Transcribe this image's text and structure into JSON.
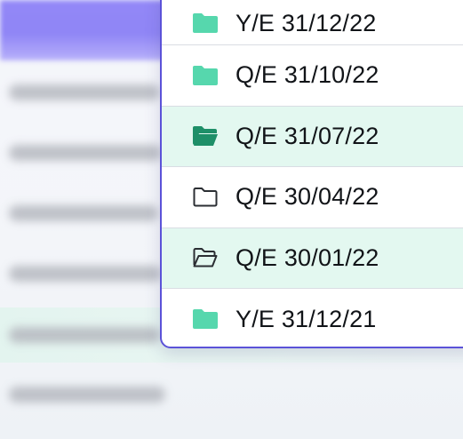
{
  "colors": {
    "accent": "#5b52d8",
    "highlight_row": "#e3f8f0",
    "folder_green": "#56d7ad",
    "folder_open_dark": "#1e8f68",
    "folder_outline": "#2b2e33"
  },
  "folder_menu": {
    "items": [
      {
        "label": "Y/E 31/12/22",
        "icon": "folder-filled-icon",
        "highlighted": false
      },
      {
        "label": "Q/E 31/10/22",
        "icon": "folder-filled-icon",
        "highlighted": false
      },
      {
        "label": "Q/E 31/07/22",
        "icon": "folder-open-filled-icon",
        "highlighted": true
      },
      {
        "label": "Q/E 30/04/22",
        "icon": "folder-outline-icon",
        "highlighted": false
      },
      {
        "label": "Q/E 30/01/22",
        "icon": "folder-open-outline-icon",
        "highlighted": true
      },
      {
        "label": "Y/E 31/12/21",
        "icon": "folder-filled-icon",
        "highlighted": false
      }
    ]
  }
}
